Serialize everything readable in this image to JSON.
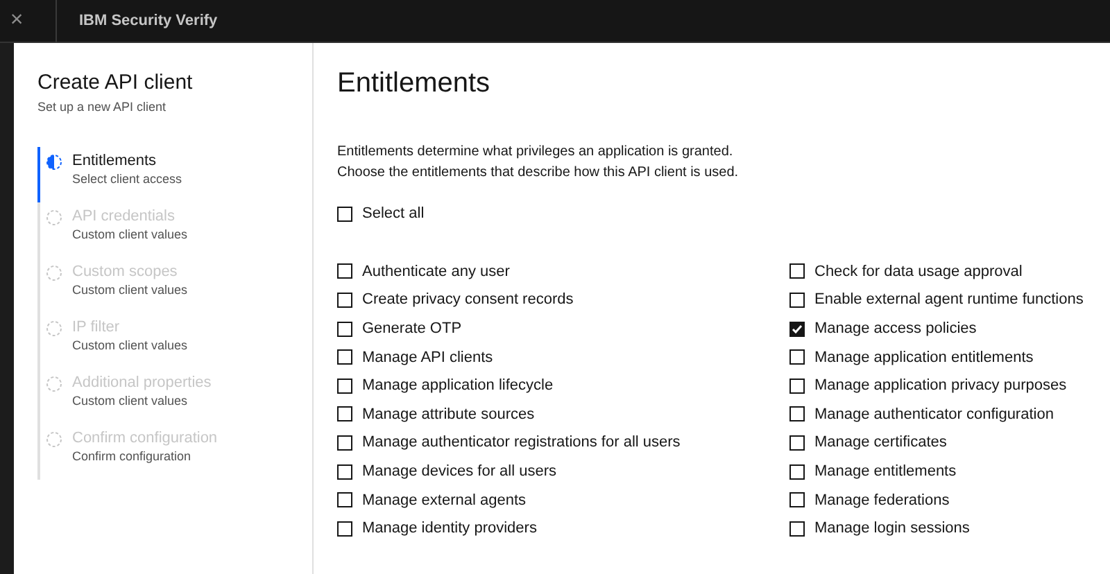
{
  "topbar": {
    "close": "×",
    "title": "IBM Security Verify"
  },
  "wizard": {
    "title": "Create API client",
    "subtitle": "Set up a new API client",
    "steps": [
      {
        "label": "Entitlements",
        "detail": "Select client access",
        "selected": true
      },
      {
        "label": "API credentials",
        "detail": "Custom client values",
        "selected": false
      },
      {
        "label": "Custom scopes",
        "detail": "Custom client values",
        "selected": false
      },
      {
        "label": "IP filter",
        "detail": "Custom client values",
        "selected": false
      },
      {
        "label": "Additional properties",
        "detail": "Custom client values",
        "selected": false
      },
      {
        "label": "Confirm configuration",
        "detail": "Confirm configuration",
        "selected": false
      }
    ]
  },
  "content": {
    "heading": "Entitlements",
    "description": [
      "Entitlements determine what privileges an application is granted.",
      "Choose the entitlements that describe how this API client is used."
    ],
    "select_all": {
      "label": "Select all",
      "checked": false
    },
    "entitlements_left": [
      {
        "label": "Authenticate any user",
        "checked": false
      },
      {
        "label": "Create privacy consent records",
        "checked": false
      },
      {
        "label": "Generate OTP",
        "checked": false
      },
      {
        "label": "Manage API clients",
        "checked": false
      },
      {
        "label": "Manage application lifecycle",
        "checked": false
      },
      {
        "label": "Manage attribute sources",
        "checked": false
      },
      {
        "label": "Manage authenticator registrations for all users",
        "checked": false
      },
      {
        "label": "Manage devices for all users",
        "checked": false
      },
      {
        "label": "Manage external agents",
        "checked": false
      },
      {
        "label": "Manage identity providers",
        "checked": false
      }
    ],
    "entitlements_right": [
      {
        "label": "Check for data usage approval",
        "checked": false
      },
      {
        "label": "Enable external agent runtime functions",
        "checked": false
      },
      {
        "label": "Manage access policies",
        "checked": true
      },
      {
        "label": "Manage application entitlements",
        "checked": false
      },
      {
        "label": "Manage application privacy purposes",
        "checked": false
      },
      {
        "label": "Manage authenticator configuration",
        "checked": false
      },
      {
        "label": "Manage certificates",
        "checked": false
      },
      {
        "label": "Manage entitlements",
        "checked": false
      },
      {
        "label": "Manage federations",
        "checked": false
      },
      {
        "label": "Manage login sessions",
        "checked": false
      }
    ]
  }
}
